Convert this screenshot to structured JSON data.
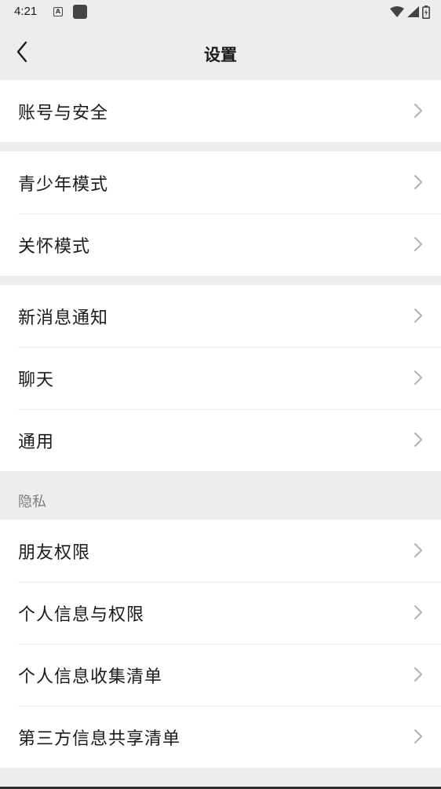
{
  "status_bar": {
    "time": "4:21",
    "left_icons": [
      "text-a-icon",
      "square-app-icon"
    ],
    "right_icons": [
      "wifi-icon",
      "signal-icon",
      "battery-icon"
    ]
  },
  "header": {
    "title": "设置",
    "back_icon": "chevron-left-icon"
  },
  "groups": [
    {
      "items": [
        {
          "label": "账号与安全"
        }
      ]
    },
    {
      "items": [
        {
          "label": "青少年模式"
        },
        {
          "label": "关怀模式"
        }
      ]
    },
    {
      "items": [
        {
          "label": "新消息通知"
        },
        {
          "label": "聊天"
        },
        {
          "label": "通用"
        }
      ]
    },
    {
      "section_label": "隐私",
      "items": [
        {
          "label": "朋友权限"
        },
        {
          "label": "个人信息与权限"
        },
        {
          "label": "个人信息收集清单"
        },
        {
          "label": "第三方信息共享清单"
        }
      ]
    }
  ],
  "colors": {
    "background": "#ededed",
    "card": "#ffffff",
    "text": "#1a1a1a",
    "secondary_text": "#7f7f7f",
    "chevron": "#b2b2b2"
  }
}
